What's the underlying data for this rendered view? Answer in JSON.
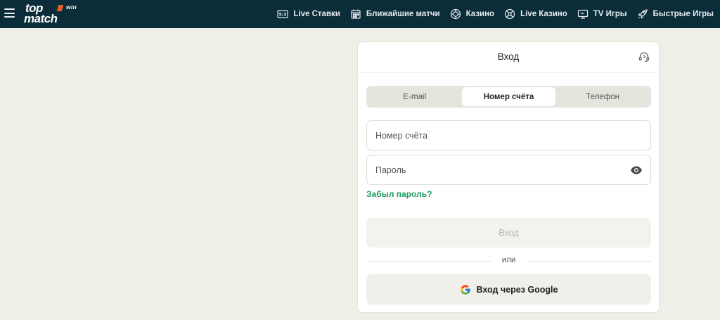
{
  "header": {
    "logo": {
      "line1": "top",
      "badge": "win",
      "line2": "match"
    },
    "nav": [
      {
        "icon": "scoreboard-icon",
        "label": "Live Ставки"
      },
      {
        "icon": "calendar-icon",
        "label": "Ближайшие матчи"
      },
      {
        "icon": "casino-chip-icon",
        "label": "Казино"
      },
      {
        "icon": "roulette-icon",
        "label": "Live Казино"
      },
      {
        "icon": "tv-icon",
        "label": "TV Игры"
      },
      {
        "icon": "rocket-icon",
        "label": "Быстрые Игры"
      }
    ]
  },
  "login": {
    "title": "Вход",
    "tabs": [
      "E-mail",
      "Номер счёта",
      "Телефон"
    ],
    "active_tab": "Номер счёта",
    "account_placeholder": "Номер счёта",
    "password_placeholder": "Пароль",
    "forgot_label": "Забыл пароль?",
    "submit_label": "Вход",
    "or_label": "или",
    "google_label": "Вход через Google"
  },
  "colors": {
    "header_bg": "#0b2d3a",
    "page_bg": "#efeee7",
    "accent_green": "#1f9a63",
    "logo_accent": "#e85c2a"
  }
}
